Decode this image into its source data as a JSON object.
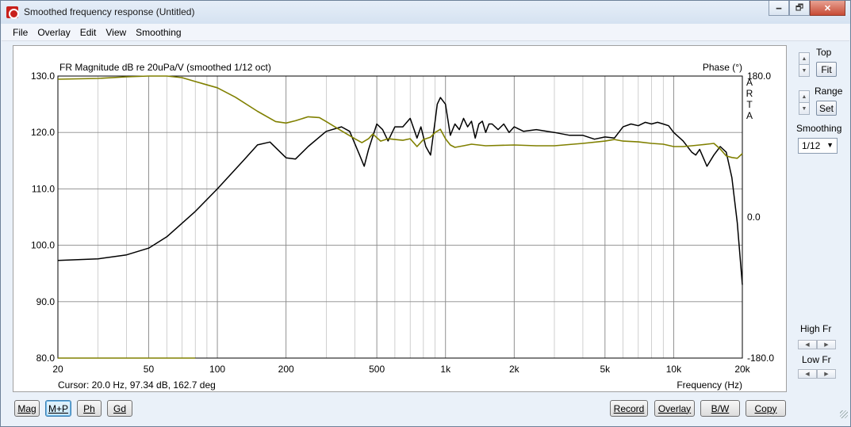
{
  "window": {
    "title": "Smoothed frequency response (Untitled)",
    "minimize": "🗕",
    "maximize": "🗗",
    "close": "✕"
  },
  "menu": [
    "File",
    "Overlay",
    "Edit",
    "View",
    "Smoothing"
  ],
  "plot": {
    "title": "FR Magnitude dB re 20uPa/V (smoothed 1/12 oct)",
    "phase_label": "Phase (°)",
    "arta_letters": [
      "A",
      "R",
      "T",
      "A"
    ],
    "cursor_readout": "Cursor: 20.0 Hz, 97.34 dB, 162.7 deg",
    "x_label": "Frequency (Hz)"
  },
  "right_panel": {
    "top_label": "Top",
    "fit_label": "Fit",
    "range_label": "Range",
    "set_label": "Set",
    "smoothing_label": "Smoothing",
    "smoothing_value": "1/12",
    "high_fr_label": "High Fr",
    "low_fr_label": "Low Fr"
  },
  "buttons": {
    "mag": "Mag",
    "mp": "M+P",
    "ph": "Ph",
    "gd": "Gd",
    "record": "Record",
    "overlay": "Overlay",
    "bw": "B/W",
    "copy": "Copy"
  },
  "colors": {
    "magnitude": "#000000",
    "phase": "#808000",
    "grid": "#b0b0b0"
  },
  "chart_data": {
    "type": "line",
    "title": "FR Magnitude dB re 20uPa/V (smoothed 1/12 oct)",
    "xlabel": "Frequency (Hz)",
    "ylabel": "",
    "y2label": "Phase (°)",
    "x_scale": "log",
    "xlim": [
      20,
      20000
    ],
    "ylim": [
      80,
      130
    ],
    "y2lim": [
      -180,
      180
    ],
    "x_ticks": [
      20,
      50,
      100,
      200,
      500,
      1000,
      2000,
      5000,
      10000,
      20000
    ],
    "x_tick_labels": [
      "20",
      "50",
      "100",
      "200",
      "500",
      "1k",
      "2k",
      "5k",
      "10k",
      "20k"
    ],
    "y_ticks": [
      80,
      90,
      100,
      110,
      120,
      130
    ],
    "y_tick_labels": [
      "80.0",
      "90.0",
      "100.0",
      "110.0",
      "120.0",
      "130.0"
    ],
    "y2_ticks": [
      -180,
      0,
      180
    ],
    "y2_tick_labels": [
      "-180.0",
      "0.0",
      "180.0"
    ],
    "grid": true,
    "series": [
      {
        "axis": "left",
        "points": [
          [
            20,
            97.3
          ],
          [
            30,
            97.6
          ],
          [
            40,
            98.3
          ],
          [
            50,
            99.5
          ],
          [
            60,
            101.5
          ],
          [
            80,
            106
          ],
          [
            100,
            110
          ],
          [
            130,
            115
          ],
          [
            150,
            117.8
          ],
          [
            170,
            118.3
          ],
          [
            200,
            115.5
          ],
          [
            220,
            115.3
          ],
          [
            250,
            117.5
          ],
          [
            300,
            120.2
          ],
          [
            350,
            121
          ],
          [
            380,
            120.2
          ],
          [
            420,
            116
          ],
          [
            440,
            114
          ],
          [
            460,
            117
          ],
          [
            500,
            121.5
          ],
          [
            530,
            120.5
          ],
          [
            560,
            118.5
          ],
          [
            600,
            121
          ],
          [
            650,
            121
          ],
          [
            700,
            122.5
          ],
          [
            750,
            119
          ],
          [
            780,
            121
          ],
          [
            820,
            117.5
          ],
          [
            860,
            116
          ],
          [
            900,
            122
          ],
          [
            920,
            125
          ],
          [
            950,
            126.2
          ],
          [
            1000,
            125
          ],
          [
            1050,
            119.5
          ],
          [
            1100,
            121.5
          ],
          [
            1150,
            120.5
          ],
          [
            1200,
            122.5
          ],
          [
            1250,
            121
          ],
          [
            1300,
            122
          ],
          [
            1350,
            119
          ],
          [
            1400,
            121.5
          ],
          [
            1450,
            122
          ],
          [
            1500,
            120
          ],
          [
            1550,
            121.5
          ],
          [
            1600,
            121.5
          ],
          [
            1700,
            120.5
          ],
          [
            1800,
            121.5
          ],
          [
            1900,
            120
          ],
          [
            2000,
            121
          ],
          [
            2200,
            120.2
          ],
          [
            2500,
            120.5
          ],
          [
            3000,
            120
          ],
          [
            3500,
            119.5
          ],
          [
            4000,
            119.5
          ],
          [
            4500,
            118.8
          ],
          [
            5000,
            119.2
          ],
          [
            5500,
            119
          ],
          [
            6000,
            121
          ],
          [
            6500,
            121.5
          ],
          [
            7000,
            121.2
          ],
          [
            7500,
            121.8
          ],
          [
            8000,
            121.5
          ],
          [
            8500,
            121.8
          ],
          [
            9000,
            121.5
          ],
          [
            9500,
            121.2
          ],
          [
            10000,
            120
          ],
          [
            11000,
            118.5
          ],
          [
            12000,
            116.5
          ],
          [
            12500,
            116
          ],
          [
            13000,
            117
          ],
          [
            14000,
            114
          ],
          [
            15000,
            116
          ],
          [
            16000,
            117.5
          ],
          [
            17000,
            116.5
          ],
          [
            18000,
            112
          ],
          [
            19000,
            104
          ],
          [
            20000,
            93
          ]
        ]
      },
      {
        "axis": "right",
        "points": [
          [
            20,
            176
          ],
          [
            30,
            177
          ],
          [
            40,
            179
          ],
          [
            50,
            180
          ],
          [
            60,
            180
          ],
          [
            70,
            178
          ],
          [
            80,
            173
          ],
          [
            100,
            165
          ],
          [
            120,
            153
          ],
          [
            150,
            135
          ],
          [
            180,
            122
          ],
          [
            200,
            120
          ],
          [
            220,
            123
          ],
          [
            250,
            128
          ],
          [
            280,
            127
          ],
          [
            300,
            122
          ],
          [
            350,
            110
          ],
          [
            400,
            100
          ],
          [
            430,
            95
          ],
          [
            460,
            100
          ],
          [
            480,
            106
          ],
          [
            520,
            97
          ],
          [
            560,
            100
          ],
          [
            600,
            99
          ],
          [
            650,
            98
          ],
          [
            700,
            100
          ],
          [
            750,
            90
          ],
          [
            800,
            99
          ],
          [
            860,
            102
          ],
          [
            900,
            108
          ],
          [
            950,
            112
          ],
          [
            1000,
            100
          ],
          [
            1050,
            92
          ],
          [
            1100,
            89
          ],
          [
            1200,
            91
          ],
          [
            1300,
            93
          ],
          [
            1500,
            91
          ],
          [
            2000,
            92
          ],
          [
            2500,
            91
          ],
          [
            3000,
            91
          ],
          [
            4000,
            94
          ],
          [
            5000,
            97
          ],
          [
            5500,
            99
          ],
          [
            6000,
            97
          ],
          [
            7000,
            96
          ],
          [
            8000,
            94
          ],
          [
            9000,
            93
          ],
          [
            10000,
            90
          ],
          [
            11000,
            90
          ],
          [
            12000,
            91
          ],
          [
            13000,
            92
          ],
          [
            14000,
            93
          ],
          [
            15000,
            94
          ],
          [
            16000,
            87
          ],
          [
            17000,
            78
          ],
          [
            18000,
            76
          ],
          [
            19000,
            75
          ],
          [
            20000,
            81
          ]
        ]
      },
      {
        "axis": "right",
        "points": [
          [
            20,
            -180
          ],
          [
            80,
            -180
          ]
        ]
      }
    ]
  }
}
